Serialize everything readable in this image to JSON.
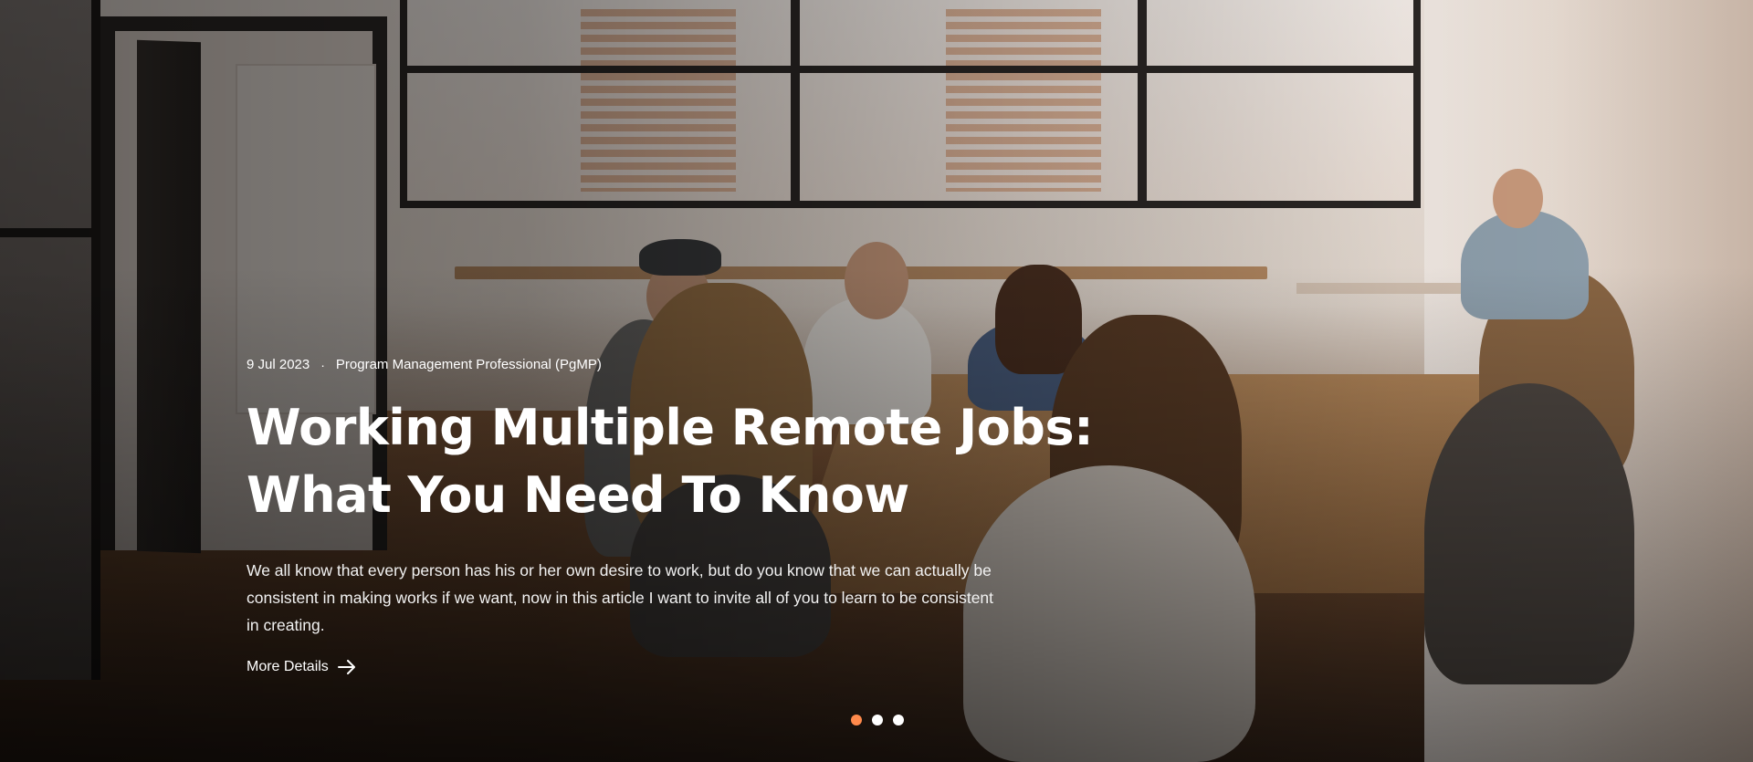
{
  "article": {
    "date": "9 Jul 2023",
    "separator": "·",
    "category": "Program Management Professional (PgMP)",
    "title_line1": "Working Multiple Remote Jobs:",
    "title_line2": "What You Need To Know",
    "summary": "We all know that every person has his or her own desire to work, but do you know that we can actually be consistent in making works if we want, now in this article I want to invite all of you to learn to be consistent in creating.",
    "cta_label": "More Details",
    "cta_icon": "arrow-right-icon"
  },
  "carousel": {
    "slide_count": 3,
    "active_index": 0,
    "accent_color": "#ff8a4c",
    "inactive_color": "#ffffff"
  }
}
